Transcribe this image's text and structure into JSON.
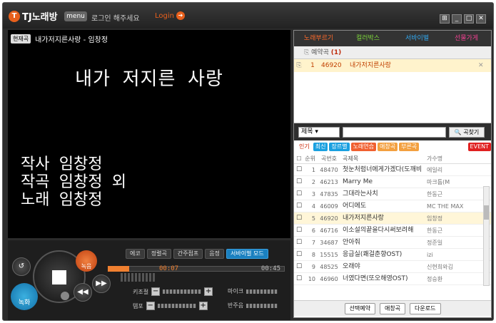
{
  "app": {
    "logo_mark": "T",
    "logo_text": "TJ노래방",
    "menu": "menu",
    "login_message": "로그인 해주세요",
    "login_label": "Login"
  },
  "window_controls": [
    "⊞",
    "_",
    "□",
    "✕"
  ],
  "now_playing": {
    "tag": "현재곡",
    "title": "내가저지른사랑 - 임창정"
  },
  "lyrics": {
    "title": "내가 저지른 사랑",
    "credits": [
      "작사 임창정",
      "작곡 임창정 외",
      "노래 임창정"
    ]
  },
  "controls": {
    "record": "녹화",
    "sing": "녹음",
    "modes": [
      "에코",
      "정렬곡",
      "간주점프",
      "음정",
      "서바이벌 모드"
    ],
    "time_current": "00:07",
    "time_total": "00:45",
    "progress": 0.12,
    "key_label": "키조절",
    "tempo_label": "템포",
    "mic_label": "마이크",
    "accomp_label": "반주음"
  },
  "right_panel": {
    "tabs": [
      {
        "label": "노래부르기",
        "color": "#ff6a2a"
      },
      {
        "label": "컬러박스",
        "color": "#7cd33a"
      },
      {
        "label": "서바이벌",
        "color": "#31a9f1"
      },
      {
        "label": "선물가게",
        "color": "#f04090"
      }
    ],
    "reserve_header": "예약곡",
    "reserve_count": "(1)",
    "reserved": [
      {
        "no": "1",
        "code": "46920",
        "title": "내가저지른사랑"
      }
    ],
    "search": {
      "select": "제목",
      "button": "곡찾기"
    },
    "filters": [
      {
        "label": "인기",
        "color": "#ffffff",
        "text": "#cc2200"
      },
      {
        "label": "최신",
        "color": "#1aa0e0",
        "text": "#ffffff"
      },
      {
        "label": "장르별",
        "color": "#1aa0e0",
        "text": "#ffffff"
      },
      {
        "label": "노래연습",
        "color": "#f06030",
        "text": "#ffffff"
      },
      {
        "label": "애창곡",
        "color": "#f3a040",
        "text": "#ffffff"
      },
      {
        "label": "부른곡",
        "color": "#f3a040",
        "text": "#ffffff"
      },
      {
        "label": "EVENT",
        "color": "#e02020",
        "text": "#ffffff"
      }
    ],
    "list_header": [
      "순위",
      "곡번호",
      "곡제목",
      "가수명"
    ],
    "songs": [
      {
        "no": "1",
        "code": "48470",
        "title": "첫눈처럼너에게가겠다(도깨비",
        "artist": "에일리"
      },
      {
        "no": "2",
        "code": "46213",
        "title": "Marry Me",
        "artist": "마크툽(M"
      },
      {
        "no": "3",
        "code": "47835",
        "title": "그대라는사치",
        "artist": "한동근"
      },
      {
        "no": "4",
        "code": "46009",
        "title": "어디에도",
        "artist": "MC THE MAX"
      },
      {
        "no": "5",
        "code": "46920",
        "title": "내가저지른사랑",
        "artist": "임창정"
      },
      {
        "no": "6",
        "code": "46716",
        "title": "이소설의끝을다시써보려해",
        "artist": "한동근"
      },
      {
        "no": "7",
        "code": "34687",
        "title": "안아줘",
        "artist": "정준일"
      },
      {
        "no": "8",
        "code": "15515",
        "title": "응급실(쾌걸춘향OST)",
        "artist": "izi"
      },
      {
        "no": "9",
        "code": "48525",
        "title": "오래야",
        "artist": "신현희와김"
      },
      {
        "no": "10",
        "code": "46960",
        "title": "너였다면(또오해영OST)",
        "artist": "정승환"
      }
    ],
    "bottom_buttons": [
      "선택예약",
      "애창곡",
      "다운로드"
    ]
  }
}
